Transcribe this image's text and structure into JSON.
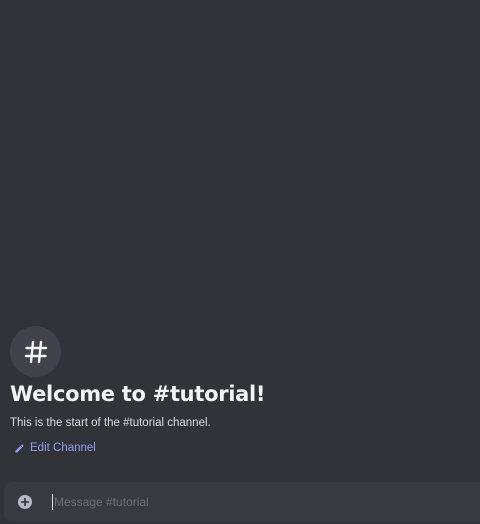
{
  "colors": {
    "background": "#313338",
    "composer_background": "#383a40",
    "icon_circle": "#41434a",
    "link": "#949cf7",
    "title": "#f2f3f5"
  },
  "channel_header": {
    "icon": "hashtag-icon",
    "title": "Welcome to #tutorial!",
    "subtitle": "This is the start of the #tutorial channel."
  },
  "edit_channel": {
    "icon": "pencil-icon",
    "label": "Edit Channel"
  },
  "composer": {
    "attach_icon": "plus-circle-icon",
    "value": "",
    "placeholder": "Message #tutorial"
  }
}
